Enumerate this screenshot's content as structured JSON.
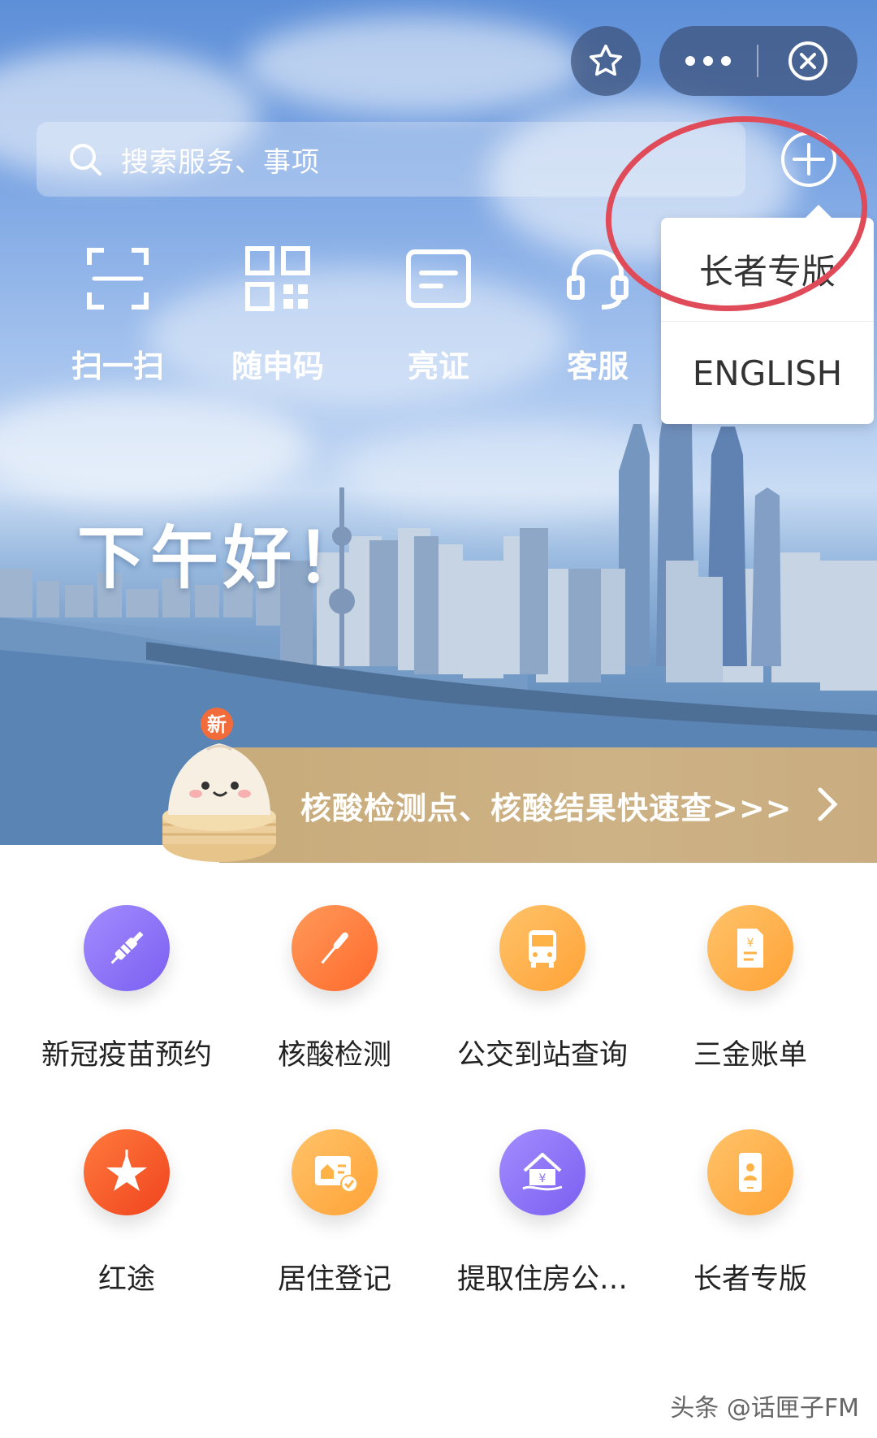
{
  "top_bar": {
    "star_icon": "star-icon",
    "more_icon": "more-dots-icon",
    "close_icon": "close-circle-icon"
  },
  "search": {
    "placeholder": "搜索服务、事项",
    "icon": "search-icon"
  },
  "plus_icon": "plus-circle-icon",
  "quick_actions": [
    {
      "label": "扫一扫",
      "icon": "scan-icon"
    },
    {
      "label": "随申码",
      "icon": "qr-code-icon"
    },
    {
      "label": "亮证",
      "icon": "card-icon"
    },
    {
      "label": "客服",
      "icon": "headset-icon"
    }
  ],
  "dropdown": {
    "items": [
      {
        "label": "长者专版"
      },
      {
        "label": "ENGLISH"
      }
    ]
  },
  "greeting": "下午好！",
  "banner": {
    "badge": "新",
    "text": "核酸检测点、核酸结果快速查>>>"
  },
  "services": [
    {
      "label": "新冠疫苗预约",
      "icon": "syringe-icon",
      "color": "#8b6ff2"
    },
    {
      "label": "核酸检测",
      "icon": "swab-icon",
      "color": "#ff7a3d"
    },
    {
      "label": "公交到站查询",
      "icon": "bus-icon",
      "color": "#ffae3f"
    },
    {
      "label": "三金账单",
      "icon": "bill-icon",
      "color": "#ffae3f"
    },
    {
      "label": "红途",
      "icon": "red-star-flag-icon",
      "color": "#ff5d2a"
    },
    {
      "label": "居住登记",
      "icon": "residence-card-icon",
      "color": "#ffae3f"
    },
    {
      "label": "提取住房公…",
      "icon": "house-fund-icon",
      "color": "#8b6ff2"
    },
    {
      "label": "长者专版",
      "icon": "elder-phone-icon",
      "color": "#ffae3f"
    }
  ],
  "watermark": "头条 @话匣子FM"
}
